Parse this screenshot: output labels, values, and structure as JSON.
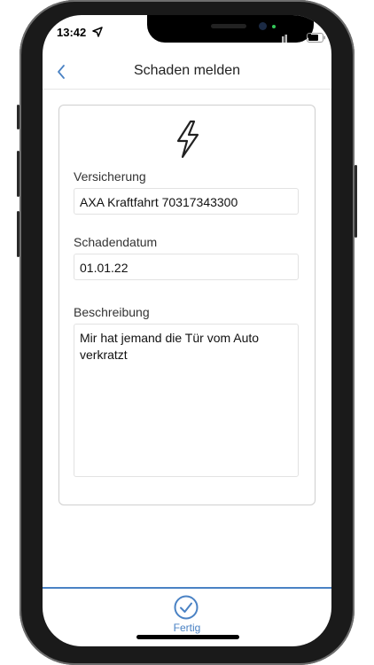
{
  "status_bar": {
    "time": "13:42"
  },
  "nav": {
    "title": "Schaden melden"
  },
  "form": {
    "insurance_label": "Versicherung",
    "insurance_value": "AXA Kraftfahrt 70317343300",
    "date_label": "Schadendatum",
    "date_value": "01.01.22",
    "description_label": "Beschreibung",
    "description_value": "Mir hat jemand die Tür vom Auto verkratzt"
  },
  "footer": {
    "done_label": "Fertig"
  },
  "colors": {
    "accent": "#4a82c4",
    "text": "#222222",
    "border": "#cfcfcf"
  },
  "icons": [
    "back-chevron-icon",
    "lightning-bolt-icon",
    "checkmark-circle-icon",
    "location-arrow-icon",
    "signal-icon",
    "wifi-icon",
    "battery-icon"
  ]
}
